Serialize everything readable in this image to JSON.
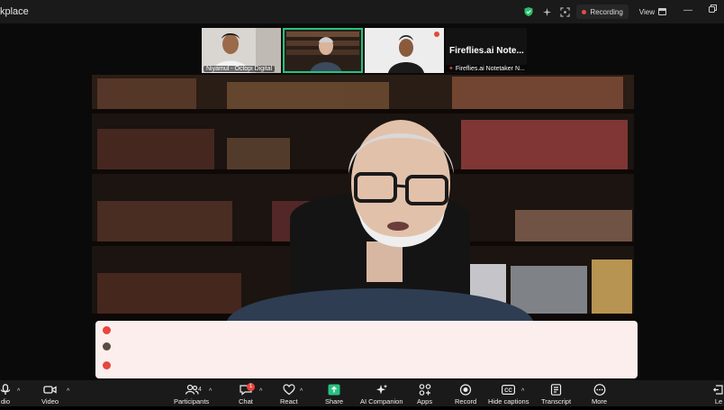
{
  "window": {
    "title": "kplace"
  },
  "status": {
    "recording_label": "Recording",
    "view_label": "View"
  },
  "thumbnails": [
    {
      "name": "Niyamul - Octopi Digital"
    },
    {
      "name": ""
    },
    {
      "name": ""
    },
    {
      "name": "Fireflies.ai Notetaker N...",
      "title": "Fireflies.ai  Note..."
    }
  ],
  "toolbar": {
    "audio": "dio",
    "video": "Video",
    "participants": "Participants",
    "participants_count": "4",
    "chat": "Chat",
    "chat_badge": "1",
    "react": "React",
    "share": "Share",
    "ai_companion": "AI Companion",
    "apps": "Apps",
    "record": "Record",
    "hide_captions": "Hide captions",
    "transcript": "Transcript",
    "more": "More",
    "leave": "Le"
  },
  "colors": {
    "active_speaker": "#26c281",
    "record_dot": "#e84a4a",
    "share_green": "#26c281",
    "captions_bg": "#fdeeee"
  }
}
